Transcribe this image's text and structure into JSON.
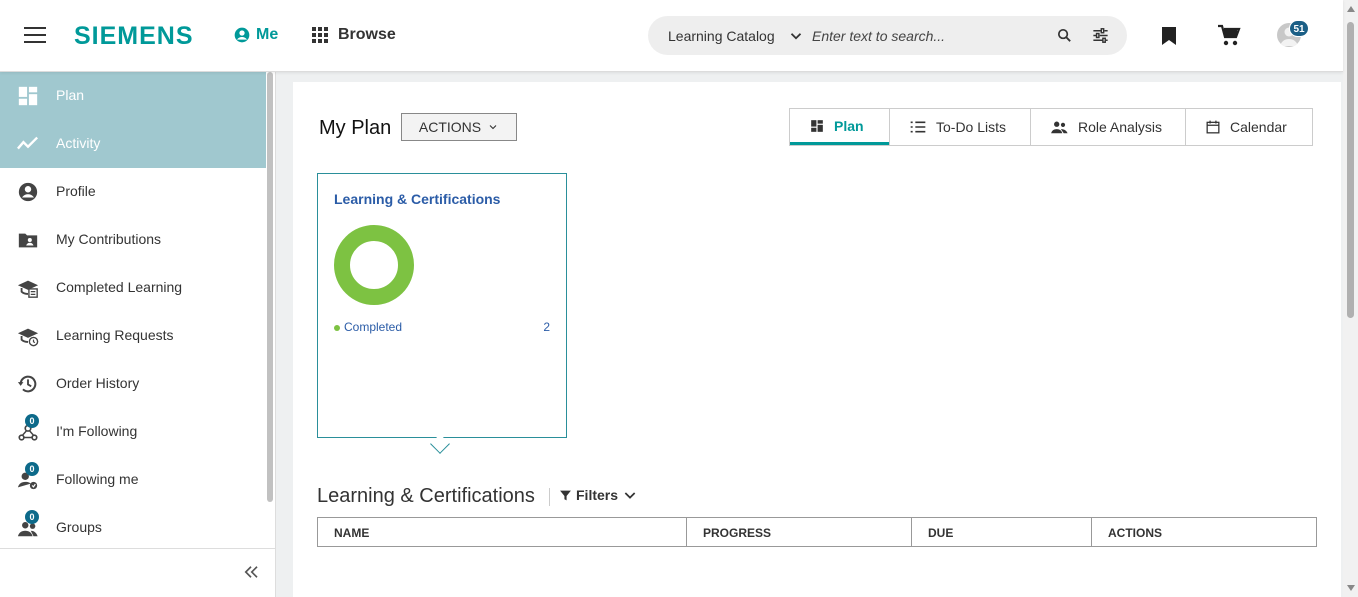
{
  "header": {
    "logo": "SIEMENS",
    "me_label": "Me",
    "browse_label": "Browse",
    "search": {
      "catalog": "Learning Catalog",
      "placeholder": "Enter text to search..."
    },
    "notification_count": "51"
  },
  "sidebar": {
    "items": [
      {
        "label": "Plan",
        "icon": "dashboard-icon",
        "active": true
      },
      {
        "label": "Activity",
        "icon": "trending-icon",
        "active": true
      },
      {
        "label": "Profile",
        "icon": "account-circle-icon"
      },
      {
        "label": "My Contributions",
        "icon": "folder-person-icon"
      },
      {
        "label": "Completed Learning",
        "icon": "graduation-cap-icon"
      },
      {
        "label": "Learning Requests",
        "icon": "graduation-clock-icon"
      },
      {
        "label": "Order History",
        "icon": "history-icon"
      },
      {
        "label": "I'm Following",
        "icon": "people-network-icon",
        "badge": "0"
      },
      {
        "label": "Following me",
        "icon": "person-follow-icon",
        "badge": "0"
      },
      {
        "label": "Groups",
        "icon": "group-icon",
        "badge": "0"
      }
    ]
  },
  "main": {
    "title": "My Plan",
    "actions_label": "ACTIONS",
    "tabs": [
      {
        "label": "Plan",
        "icon": "dashboard-icon",
        "active": true
      },
      {
        "label": "To-Do Lists",
        "icon": "list-icon"
      },
      {
        "label": "Role Analysis",
        "icon": "people-icon"
      },
      {
        "label": "Calendar",
        "icon": "calendar-icon"
      }
    ],
    "card": {
      "title": "Learning & Certifications",
      "legend_label": "Completed",
      "legend_count": "2",
      "donut_color": "#7dc242"
    },
    "section_title": "Learning & Certifications",
    "filters_label": "Filters",
    "table_columns": [
      "NAME",
      "PROGRESS",
      "DUE",
      "ACTIONS"
    ]
  },
  "colors": {
    "brand": "#009999",
    "active_nav": "#a0c8cf",
    "link_blue": "#2b5ca7"
  }
}
